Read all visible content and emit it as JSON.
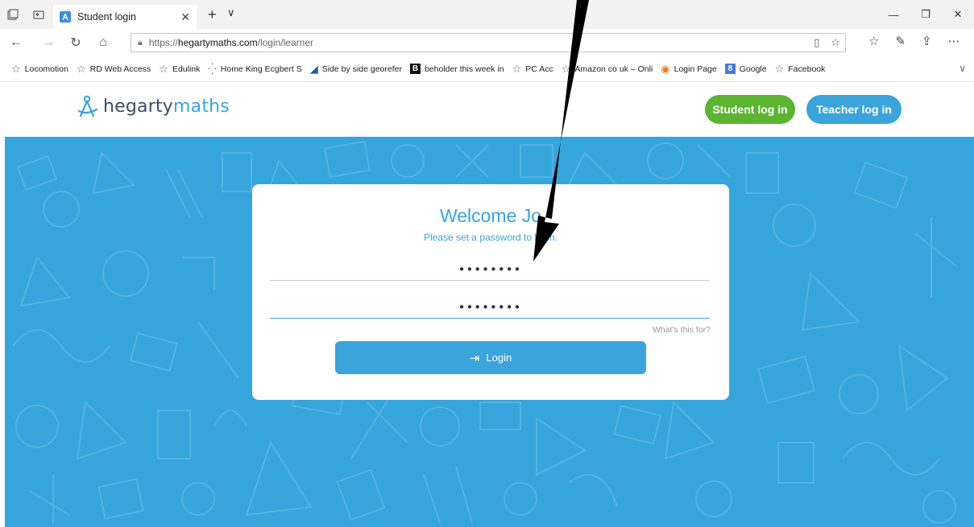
{
  "browser": {
    "tab": {
      "title": "Student login"
    },
    "address": {
      "url_prefix": "https://",
      "url_host": "hegartymaths.com",
      "url_path": "/login/learner"
    },
    "favorites": [
      {
        "label": "Locomotion",
        "icon": "star-icon"
      },
      {
        "label": "RD Web Access",
        "icon": "star-icon"
      },
      {
        "label": "Edulink",
        "icon": "star-icon"
      },
      {
        "label": "Home King Ecgbert S",
        "icon": "dots-icon"
      },
      {
        "label": "Side by side georefer",
        "icon": "shark-icon"
      },
      {
        "label": "beholder this week in",
        "icon": "b-icon"
      },
      {
        "label": "PC Acc",
        "icon": "star-icon"
      },
      {
        "label": "Amazon co uk – Onli",
        "icon": "star-icon"
      },
      {
        "label": "Login Page",
        "icon": "globe-icon"
      },
      {
        "label": "Google",
        "icon": "google-icon"
      },
      {
        "label": "Facebook",
        "icon": "star-icon"
      }
    ]
  },
  "header": {
    "logo_part1": "hegarty",
    "logo_part2": "maths",
    "student_login_label": "Student log in",
    "teacher_login_label": "Teacher log in"
  },
  "login": {
    "welcome": "Welcome Jo",
    "subtitle": "Please set a password to login.",
    "password1": "••••••••",
    "password2": "••••••••",
    "whats_this": "What's this for?",
    "button_label": "Login"
  },
  "colors": {
    "brand_blue": "#3aa4db",
    "student_green": "#5cb531",
    "hero_bg": "#36a5dc",
    "arrow": "#000000"
  }
}
